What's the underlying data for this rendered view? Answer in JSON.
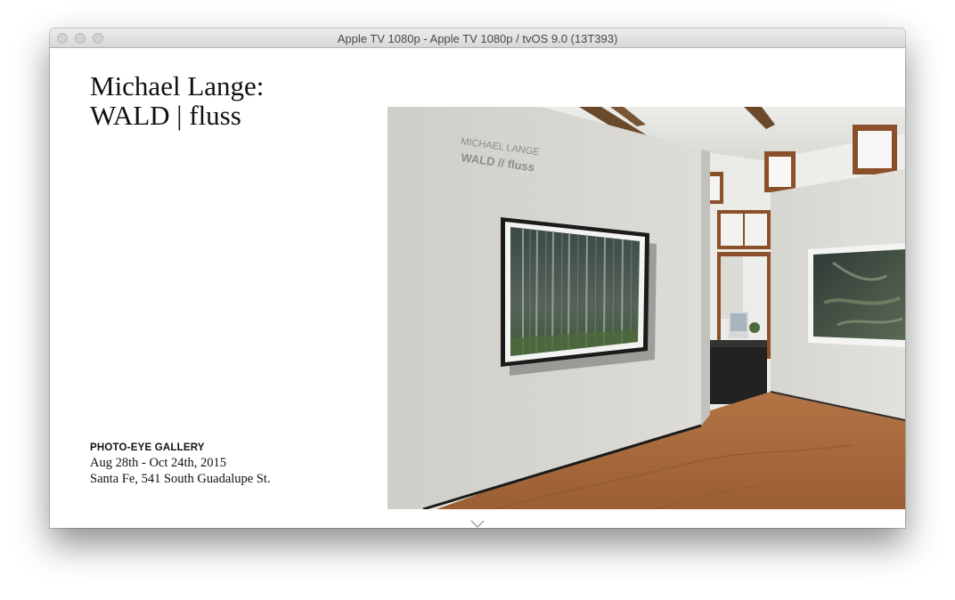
{
  "window": {
    "title": "Apple TV 1080p - Apple TV 1080p / tvOS 9.0 (13T393)"
  },
  "exhibit": {
    "title_line1": "Michael Lange:",
    "title_line2": "WALD | fluss",
    "gallery": "PHOTO-EYE GALLERY",
    "dates": "Aug 28th - Oct 24th, 2015",
    "location": "Santa Fe, 541 South Guadalupe St."
  },
  "photo": {
    "wall_text_line1": "MICHAEL LANGE",
    "wall_text_line2": "WALD // fluss"
  },
  "icons": {
    "scroll_indicator": "chevron-down-icon",
    "window_controls": [
      "close-icon",
      "minimize-icon",
      "zoom-icon"
    ]
  },
  "colors": {
    "wall": "#d6d5cf",
    "floor": "#a8683a",
    "window_frame": "#9a5a2e"
  }
}
